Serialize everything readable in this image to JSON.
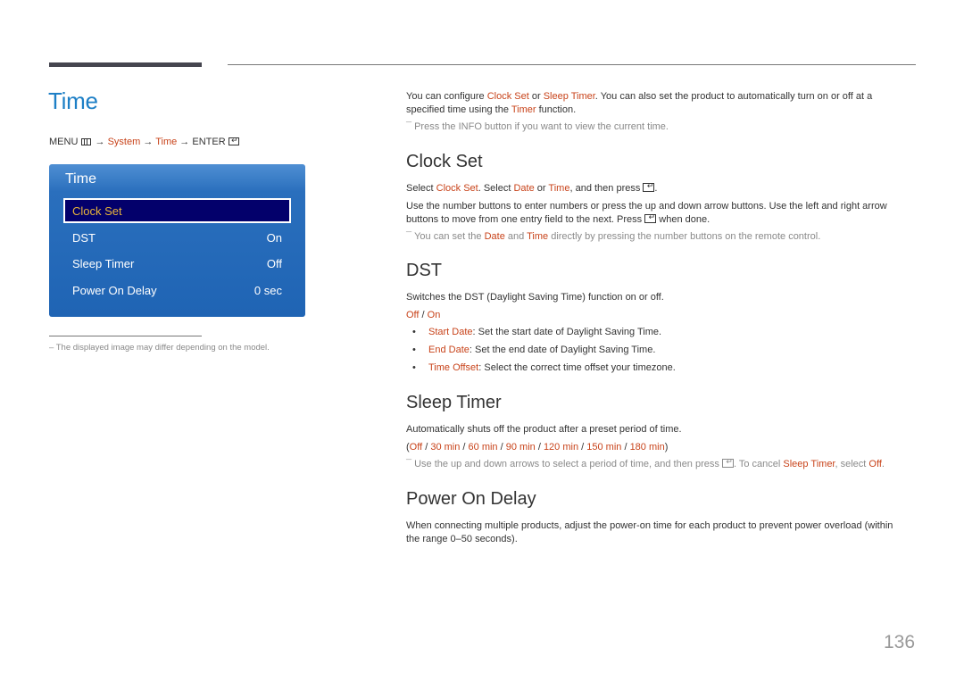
{
  "page_title": "Time",
  "menu_path": {
    "menu": "MENU",
    "arrow": "→",
    "system": "System",
    "time": "Time",
    "enter": "ENTER"
  },
  "osd": {
    "title": "Time",
    "items": [
      {
        "label": "Clock Set",
        "value": "",
        "selected": true
      },
      {
        "label": "DST",
        "value": "On"
      },
      {
        "label": "Sleep Timer",
        "value": "Off"
      },
      {
        "label": "Power On Delay",
        "value": "0 sec"
      }
    ]
  },
  "footnote": "–  The displayed image may differ depending on the model.",
  "intro": {
    "p1_a": "You can configure ",
    "p1_clock": "Clock Set",
    "p1_b": " or ",
    "p1_sleep": "Sleep Timer",
    "p1_c": ". You can also set the product to automatically turn on or off at a",
    "p1_d": "specified time using the ",
    "p1_timer": "Timer",
    "p1_e": " function.",
    "note": "Press the INFO button if you want to view the current time."
  },
  "clock_set": {
    "heading": "Clock Set",
    "p1_a": "Select ",
    "p1_clock": "Clock Set",
    "p1_b": ". Select ",
    "p1_date": "Date",
    "p1_c": " or ",
    "p1_time": "Time",
    "p1_d": ", and then press",
    "p1_e": ".",
    "p2_a": "Use the number buttons to enter numbers or press the up and down arrow buttons. Use the left and right arrow",
    "p2_b": "buttons to move from one entry field to the next. Press",
    "p2_c": "when done.",
    "note_a": "You can set the ",
    "note_date": "Date",
    "note_b": " and ",
    "note_time": "Time",
    "note_c": " directly by pressing the number buttons on the remote control."
  },
  "dst": {
    "heading": "DST",
    "p1": "Switches the DST (Daylight Saving Time) function on or off.",
    "opt_off": "Off",
    "opt_sep": " / ",
    "opt_on": "On",
    "bullets": [
      {
        "term": "Start Date",
        "text": ": Set the start date of Daylight Saving Time."
      },
      {
        "term": "End Date",
        "text": ": Set the end date of Daylight Saving Time."
      },
      {
        "term": "Time Offset",
        "text": ": Select the correct time offset your timezone."
      }
    ]
  },
  "sleep_timer": {
    "heading": "Sleep Timer",
    "p1": "Automatically shuts off the product after a preset period of time.",
    "options": [
      "Off",
      "30 min",
      "60 min",
      "90 min",
      "120 min",
      "150 min",
      "180 min"
    ],
    "note_a": "Use the up and down arrows to select a period of time, and then press",
    "note_b": ". To cancel ",
    "note_sleep": "Sleep Timer",
    "note_c": ", select ",
    "note_off": "Off",
    "note_d": "."
  },
  "power_on_delay": {
    "heading": "Power On Delay",
    "p1_a": "When connecting multiple products, adjust the power-on time for each product to prevent power overload (within",
    "p1_b": "the range 0–50 seconds)."
  },
  "page_number": "136"
}
